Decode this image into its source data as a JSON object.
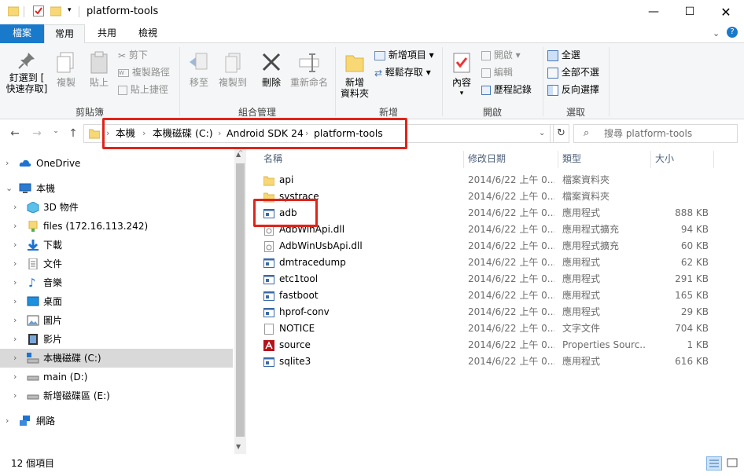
{
  "window": {
    "title": "platform-tools"
  },
  "tabs": [
    {
      "label": "檔案"
    },
    {
      "label": "常用"
    },
    {
      "label": "共用"
    },
    {
      "label": "檢視"
    }
  ],
  "ribbon": {
    "clipboard": {
      "pin_label_1": "釘選到 [",
      "pin_label_2": "快速存取]",
      "copy_label": "複製",
      "paste_label": "貼上",
      "cut_label": "剪下",
      "copy_path_label": "複製路徑",
      "paste_shortcut_label": "貼上捷徑",
      "group_label": "剪貼簿"
    },
    "organize": {
      "move_label": "移至",
      "copy_to_label": "複製到",
      "delete_label": "刪除",
      "rename_label": "重新命名",
      "group_label": "組合管理"
    },
    "new": {
      "new_folder_label_1": "新增",
      "new_folder_label_2": "資料夾",
      "new_item_label": "新增項目 ▾",
      "easy_access_label": "輕鬆存取 ▾",
      "group_label": "新增"
    },
    "open": {
      "properties_label": "內容",
      "open_label": "開啟 ▾",
      "edit_label": "編輯",
      "history_label": "歷程記錄",
      "group_label": "開啟"
    },
    "select": {
      "select_all_label": "全選",
      "select_none_label": "全部不選",
      "invert_label": "反向選擇",
      "group_label": "選取"
    }
  },
  "address": {
    "crumbs": [
      "本機",
      "本機磁碟 (C:)",
      "Android SDK 24",
      "platform-tools"
    ],
    "search_placeholder": "搜尋 platform-tools"
  },
  "nav": {
    "items": [
      {
        "label": "OneDrive"
      },
      {
        "label": "本機"
      },
      {
        "label": "3D 物件"
      },
      {
        "label": "files (172.16.113.242)"
      },
      {
        "label": "下載"
      },
      {
        "label": "文件"
      },
      {
        "label": "音樂"
      },
      {
        "label": "桌面"
      },
      {
        "label": "圖片"
      },
      {
        "label": "影片"
      },
      {
        "label": "本機磁碟 (C:)"
      },
      {
        "label": "main (D:)"
      },
      {
        "label": "新增磁碟區 (E:)"
      },
      {
        "label": "網路"
      }
    ]
  },
  "list": {
    "headers": {
      "name": "名稱",
      "date": "修改日期",
      "type": "類型",
      "size": "大小"
    },
    "rows": [
      {
        "name": "api",
        "date": "2014/6/22 上午 0...",
        "type": "檔案資料夾",
        "size": ""
      },
      {
        "name": "systrace",
        "date": "2014/6/22 上午 0...",
        "type": "檔案資料夾",
        "size": ""
      },
      {
        "name": "adb",
        "date": "2014/6/22 上午 0...",
        "type": "應用程式",
        "size": "888 KB"
      },
      {
        "name": "AdbWinApi.dll",
        "date": "2014/6/22 上午 0...",
        "type": "應用程式擴充",
        "size": "94 KB"
      },
      {
        "name": "AdbWinUsbApi.dll",
        "date": "2014/6/22 上午 0...",
        "type": "應用程式擴充",
        "size": "60 KB"
      },
      {
        "name": "dmtracedump",
        "date": "2014/6/22 上午 0...",
        "type": "應用程式",
        "size": "62 KB"
      },
      {
        "name": "etc1tool",
        "date": "2014/6/22 上午 0...",
        "type": "應用程式",
        "size": "291 KB"
      },
      {
        "name": "fastboot",
        "date": "2014/6/22 上午 0...",
        "type": "應用程式",
        "size": "165 KB"
      },
      {
        "name": "hprof-conv",
        "date": "2014/6/22 上午 0...",
        "type": "應用程式",
        "size": "29 KB"
      },
      {
        "name": "NOTICE",
        "date": "2014/6/22 上午 0...",
        "type": "文字文件",
        "size": "704 KB"
      },
      {
        "name": "source",
        "date": "2014/6/22 上午 0...",
        "type": "Properties Sourc...",
        "size": "1 KB"
      },
      {
        "name": "sqlite3",
        "date": "2014/6/22 上午 0...",
        "type": "應用程式",
        "size": "616 KB"
      }
    ]
  },
  "status": {
    "count": "12 個項目"
  },
  "colors": {
    "accent": "#1979ca",
    "highlight": "#e0241a",
    "selected": "#d9d9d9"
  }
}
